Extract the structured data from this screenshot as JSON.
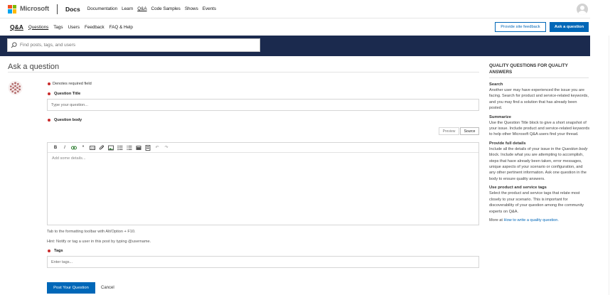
{
  "colors": {
    "accent": "#0067b8",
    "banner": "#1b2a4e",
    "required": "#c92b2b",
    "ms_red": "#f25022",
    "ms_green": "#7fba00",
    "ms_blue": "#00a4ef",
    "ms_yellow": "#ffb900"
  },
  "header": {
    "brand": "Microsoft",
    "product": "Docs",
    "nav": [
      "Documentation",
      "Learn",
      "Q&A",
      "Code Samples",
      "Shows",
      "Events"
    ],
    "active_nav": "Q&A"
  },
  "subheader": {
    "brand": "Q&A",
    "nav": [
      "Questions",
      "Tags",
      "Users",
      "Feedback",
      "FAQ & Help"
    ],
    "feedback_button": "Provide site feedback",
    "ask_button": "Ask a question"
  },
  "search": {
    "placeholder": "Find posts, tags, and users"
  },
  "form": {
    "page_title": "Ask a question",
    "required_note": "Denotes required field",
    "title_label": "Question Title",
    "title_placeholder": "Type your question...",
    "body_label": "Question body",
    "tab_preview": "Preview",
    "tab_source": "Source",
    "toolbar_icons": [
      "bold-icon",
      "italic-icon",
      "link-icon",
      "quote-icon",
      "code-icon",
      "attachment-icon",
      "image-icon",
      "bulleted-list-icon",
      "numbered-list-icon",
      "table-icon",
      "html-icon",
      "undo-icon",
      "redo-icon"
    ],
    "body_placeholder": "Add some details...",
    "hint_toolbar": "Tab to the formatting toolbar with Alt/Option + F10.",
    "hint_notify": "Hint: Notify or tag a user in this post by typing @username.",
    "tags_label": "Tags",
    "tags_placeholder": "Enter tags...",
    "post_button": "Post Your Question",
    "cancel_button": "Cancel"
  },
  "sidebar": {
    "title": "QUALITY QUESTIONS FOR QUALITY ANSWERS",
    "sections": [
      {
        "heading": "Search",
        "text": "Another user may have experienced the issue you are facing. Search for product and service-related keywords, and you may find a solution that has already been posted."
      },
      {
        "heading": "Summarize",
        "text": "Use the Question Title block to give a short snapshot of your issue. Include product and service-related keywords to help other Microsoft Q&A users find your thread."
      },
      {
        "heading": "Provide full details",
        "text_before": "Include all the details of your issue in the ",
        "text_em": "Question body",
        "text_after": " block. Include what you are attempting to accomplish, steps that have already been taken, error messages, unique aspects of your scenario or configuration, and any other pertinent information. Ask one question in the body to ensure quality answers."
      },
      {
        "heading": "Use product and service tags",
        "text": "Select the product and service tags that relate most closely to your scenario. This is important for discoverability of your question among the community experts on Q&A."
      }
    ],
    "more_prefix": "More at ",
    "more_link": "How to write a quality question."
  }
}
